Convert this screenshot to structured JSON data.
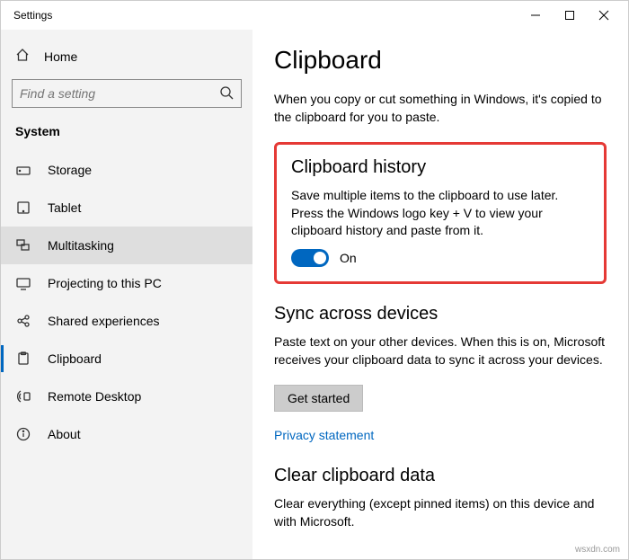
{
  "window": {
    "title": "Settings"
  },
  "sidebar": {
    "home": "Home",
    "search_placeholder": "Find a setting",
    "category": "System",
    "items": [
      {
        "label": "Storage"
      },
      {
        "label": "Tablet"
      },
      {
        "label": "Multitasking"
      },
      {
        "label": "Projecting to this PC"
      },
      {
        "label": "Shared experiences"
      },
      {
        "label": "Clipboard"
      },
      {
        "label": "Remote Desktop"
      },
      {
        "label": "About"
      }
    ]
  },
  "page": {
    "title": "Clipboard",
    "intro": "When you copy or cut something in Windows, it's copied to the clipboard for you to paste.",
    "history": {
      "title": "Clipboard history",
      "desc": "Save multiple items to the clipboard to use later. Press the Windows logo key + V to view your clipboard history and paste from it.",
      "toggle_label": "On"
    },
    "sync": {
      "title": "Sync across devices",
      "desc": "Paste text on your other devices. When this is on, Microsoft receives your clipboard data to sync it across your devices.",
      "button": "Get started",
      "link": "Privacy statement"
    },
    "clear": {
      "title": "Clear clipboard data",
      "desc": "Clear everything (except pinned items) on this device and with Microsoft."
    }
  },
  "watermark": "wsxdn.com"
}
